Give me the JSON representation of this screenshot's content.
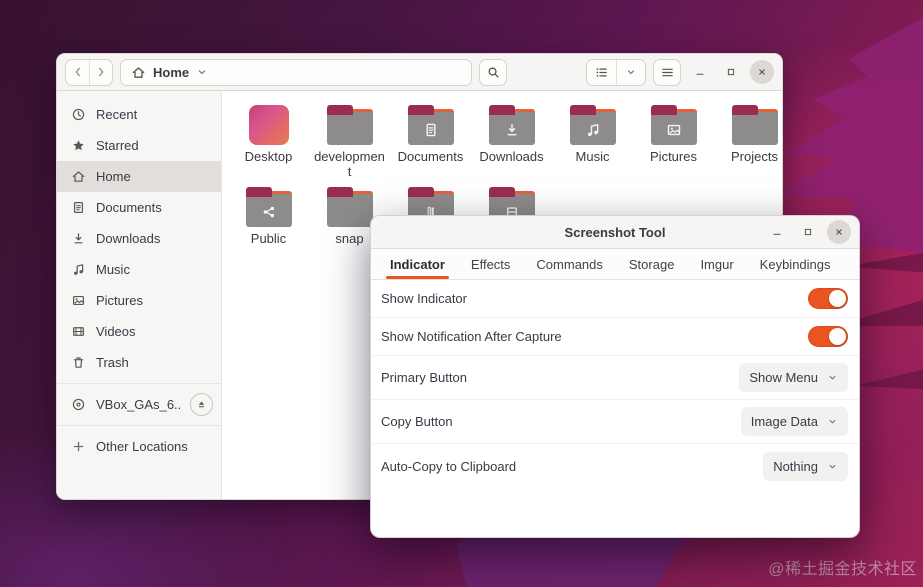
{
  "colors": {
    "accent": "#e95420",
    "folder_body": "#8e8c8a",
    "folder_tab": "#9c2b52",
    "folder_edge": "#e2623c"
  },
  "watermark": "@稀土掘金技术社区",
  "files": {
    "header": {
      "location": "Home"
    },
    "sidebar": {
      "items": [
        {
          "label": "Recent",
          "icon": "clock-icon"
        },
        {
          "label": "Starred",
          "icon": "star-icon"
        },
        {
          "label": "Home",
          "icon": "home-icon",
          "selected": true
        },
        {
          "label": "Documents",
          "icon": "document-icon"
        },
        {
          "label": "Downloads",
          "icon": "download-icon"
        },
        {
          "label": "Music",
          "icon": "music-note-icon"
        },
        {
          "label": "Pictures",
          "icon": "picture-icon"
        },
        {
          "label": "Videos",
          "icon": "film-icon"
        },
        {
          "label": "Trash",
          "icon": "trash-icon"
        }
      ],
      "device": {
        "label": "VBox_GAs_6....",
        "icon": "disc-icon"
      },
      "other_locations": {
        "label": "Other Locations",
        "icon": "plus-icon"
      }
    },
    "content": {
      "row1": [
        {
          "label": "Desktop",
          "emblem": "none"
        },
        {
          "label": "development",
          "emblem": "none"
        },
        {
          "label": "Documents",
          "emblem": "document"
        },
        {
          "label": "Downloads",
          "emblem": "download"
        },
        {
          "label": "Music",
          "emblem": "music"
        },
        {
          "label": "Pictures",
          "emblem": "picture"
        },
        {
          "label": "Projects",
          "emblem": "none"
        }
      ],
      "row2": [
        {
          "label": "Public",
          "emblem": "share"
        },
        {
          "label": "snap",
          "emblem": "none"
        },
        {
          "label": "",
          "emblem": "binder"
        },
        {
          "label": "",
          "emblem": "filmstrip"
        }
      ]
    }
  },
  "dialog": {
    "title": "Screenshot Tool",
    "tabs": [
      {
        "label": "Indicator",
        "active": true
      },
      {
        "label": "Effects",
        "active": false
      },
      {
        "label": "Commands",
        "active": false
      },
      {
        "label": "Storage",
        "active": false
      },
      {
        "label": "Imgur",
        "active": false
      },
      {
        "label": "Keybindings",
        "active": false
      }
    ],
    "rows": [
      {
        "label": "Show Indicator",
        "type": "toggle",
        "value": "on"
      },
      {
        "label": "Show Notification After Capture",
        "type": "toggle",
        "value": "on"
      },
      {
        "label": "Primary Button",
        "type": "dropdown",
        "value": "Show Menu"
      },
      {
        "label": "Copy Button",
        "type": "dropdown",
        "value": "Image Data"
      },
      {
        "label": "Auto-Copy to Clipboard",
        "type": "dropdown",
        "value": "Nothing"
      }
    ]
  }
}
